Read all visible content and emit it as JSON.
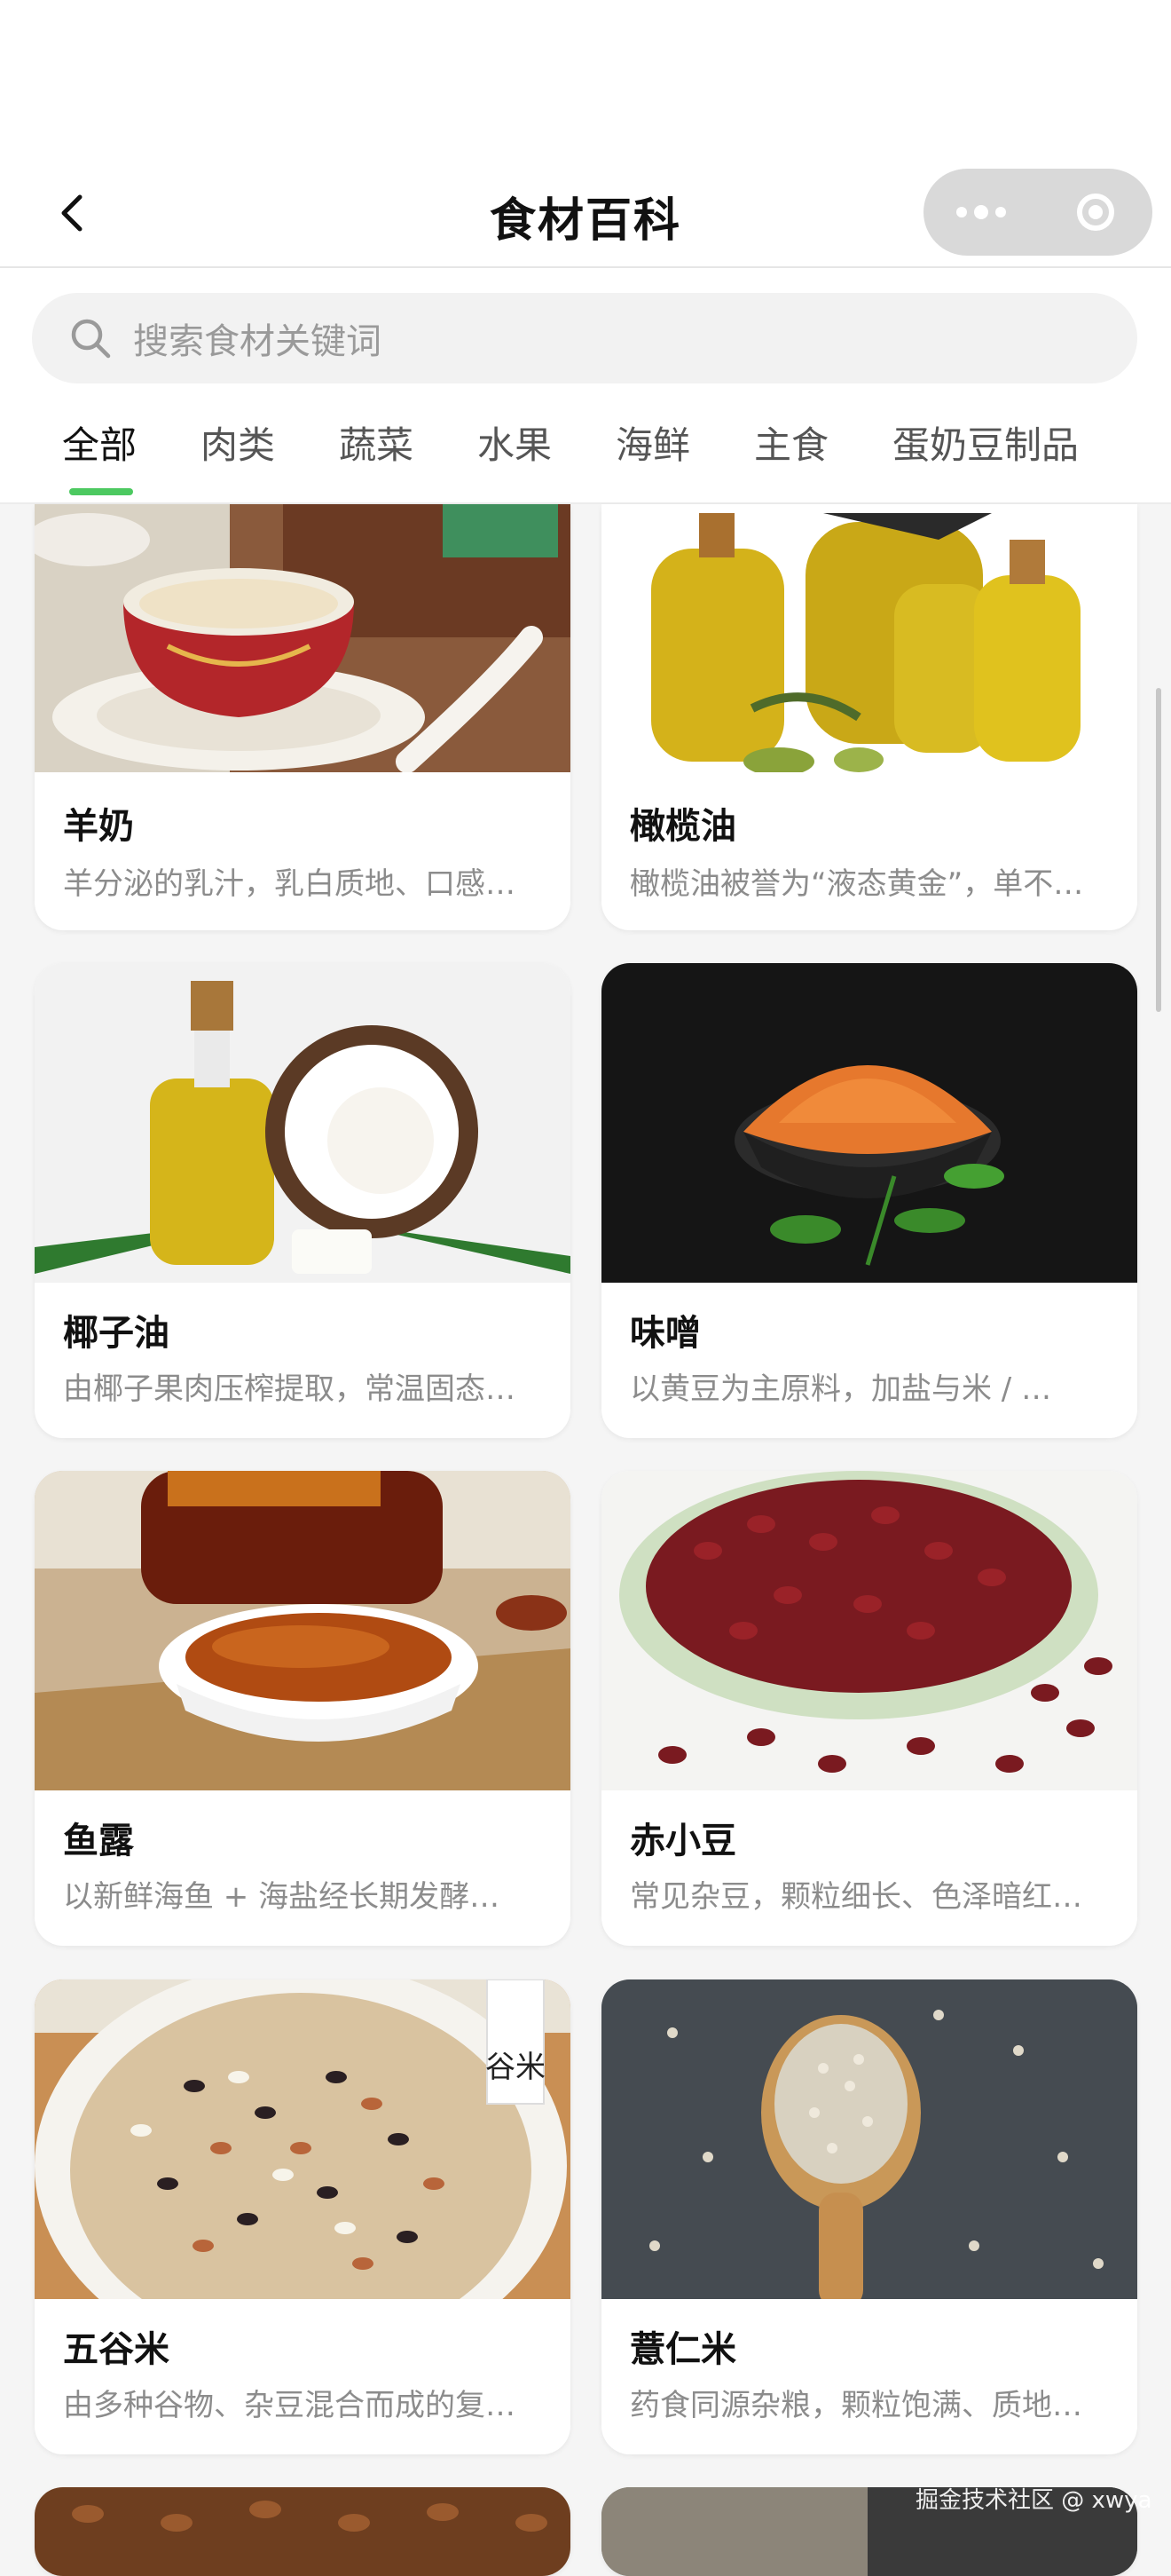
{
  "header": {
    "title": "食材百科"
  },
  "search": {
    "placeholder": "搜索食材关键词"
  },
  "tabs": [
    {
      "label": "全部",
      "active": true
    },
    {
      "label": "肉类",
      "active": false
    },
    {
      "label": "蔬菜",
      "active": false
    },
    {
      "label": "水果",
      "active": false
    },
    {
      "label": "海鲜",
      "active": false
    },
    {
      "label": "主食",
      "active": false
    },
    {
      "label": "蛋奶豆制品",
      "active": false
    }
  ],
  "colors": {
    "accent": "#4cc960"
  },
  "items": [
    {
      "name": "羊奶",
      "desc": "羊分泌的乳汁，乳白质地、口感…"
    },
    {
      "name": "橄榄油",
      "desc": "橄榄油被誉为“液态黄金”，单不…"
    },
    {
      "name": "椰子油",
      "desc": "由椰子果肉压榨提取，常温固态…"
    },
    {
      "name": "味噌",
      "desc": "以黄豆为主原料，加盐与米 / …"
    },
    {
      "name": "鱼露",
      "desc": "以新鲜海鱼 + 海盐经长期发酵…"
    },
    {
      "name": "赤小豆",
      "desc": "常见杂豆，颗粒细长、色泽暗红…"
    },
    {
      "name": "五谷米",
      "desc": "由多种谷物、杂豆混合而成的复…"
    },
    {
      "name": "薏仁米",
      "desc": "药食同源杂粮，颗粒饱满、质地…"
    }
  ],
  "photo_labels": {
    "grain_jar_label": "谷米"
  },
  "watermark": "掘金技术社区 @ xwya"
}
